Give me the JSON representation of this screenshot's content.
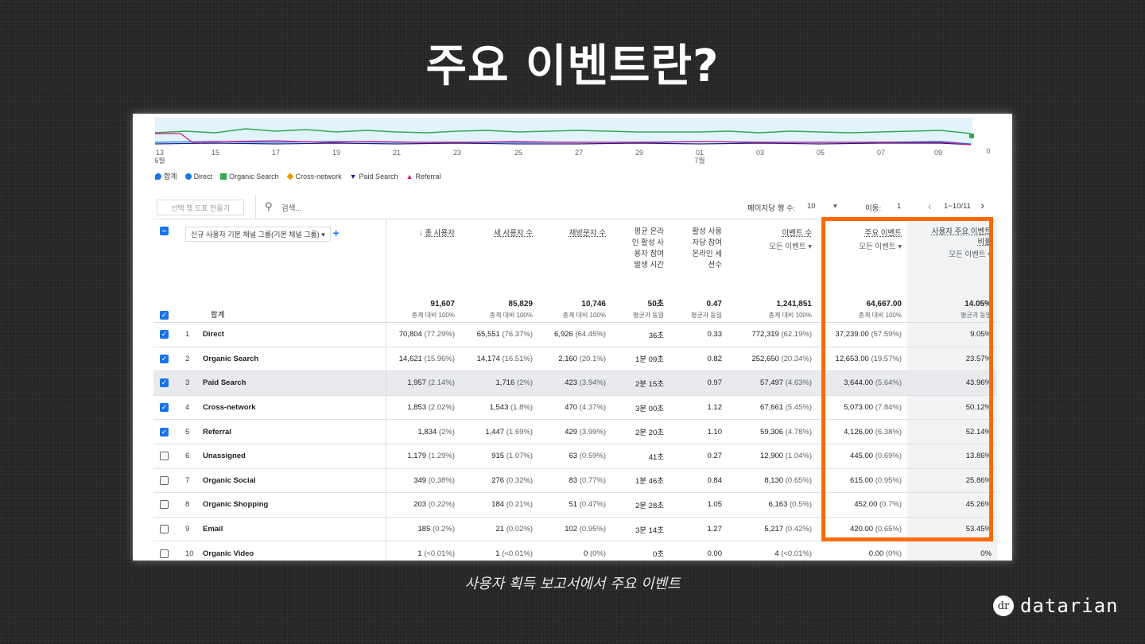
{
  "slide_title": "주요 이벤트란?",
  "caption": "사용자 획득 보고서에서 주요 이벤트",
  "brand": {
    "logo_text": "dr",
    "name": "datarian"
  },
  "chart": {
    "x_ticks": [
      "13\n6월",
      "15",
      "17",
      "19",
      "21",
      "23",
      "25",
      "27",
      "29",
      "01\n7월",
      "03",
      "05",
      "07",
      "09"
    ],
    "y_right_tick": "0",
    "legend": [
      {
        "label": "합계",
        "color": "#1a73e8",
        "icon": "pin-icon"
      },
      {
        "label": "Direct",
        "color": "#1a73e8",
        "icon": "circle-icon"
      },
      {
        "label": "Organic Search",
        "color": "#34a853",
        "icon": "square-icon"
      },
      {
        "label": "Cross-network",
        "color": "#f29900",
        "icon": "diamond-icon"
      },
      {
        "label": "Paid Search",
        "color": "#1a237e",
        "icon": "triangle-down-icon"
      },
      {
        "label": "Referral",
        "color": "#d01884",
        "icon": "triangle-up-icon"
      }
    ]
  },
  "toolbar": {
    "make_chart": "선택 행 도표 만들기",
    "search_placeholder": "검색...",
    "rows_per_page_label": "페이지당 행 수:",
    "rows_per_page": "10",
    "goto_label": "이동:",
    "goto_value": "1",
    "range": "1~10/11"
  },
  "dimension": {
    "label": "신규 사용자 기본 채널 그룹(기본 채널 그룹)"
  },
  "columns": [
    {
      "label": "총 사용자",
      "sub": ""
    },
    {
      "label": "새 사용자 수",
      "sub": ""
    },
    {
      "label": "재방문자 수",
      "sub": ""
    },
    {
      "label": "평균 온라\n인 활성 사\n용자 참여\n발생 시간",
      "sub": ""
    },
    {
      "label": "활성 사용\n자당 참여\n온라인 세\n션수",
      "sub": ""
    },
    {
      "label": "이벤트 수",
      "sub": "모든 이벤트"
    },
    {
      "label": "주요 이벤트",
      "sub": "모든 이벤트"
    },
    {
      "label": "사용자 주요 이벤트\n비율",
      "sub": "모든 이벤트"
    }
  ],
  "totals": {
    "label": "합계",
    "values": [
      {
        "v": "91,607",
        "s": "총계 대비 100%"
      },
      {
        "v": "85,829",
        "s": "총계 대비 100%"
      },
      {
        "v": "10,746",
        "s": "총계 대비 100%"
      },
      {
        "v": "50초",
        "s": "평균과 동일"
      },
      {
        "v": "0.47",
        "s": "평균과 동일"
      },
      {
        "v": "1,241,851",
        "s": "총계 대비 100%"
      },
      {
        "v": "64,667.00",
        "s": "총계 대비 100%"
      },
      {
        "v": "14.05%",
        "s": "평균과 동일"
      }
    ]
  },
  "rows": [
    {
      "rank": "1",
      "name": "Direct",
      "checked": true,
      "c": [
        [
          "70,804",
          "(77.29%)"
        ],
        [
          "65,551",
          "(76.37%)"
        ],
        [
          "6,926",
          "(64.45%)"
        ],
        [
          "36초",
          ""
        ],
        [
          "0.33",
          ""
        ],
        [
          "772,319",
          "(62.19%)"
        ],
        [
          "37,239.00",
          "(57.59%)"
        ],
        [
          "9.05%",
          ""
        ]
      ]
    },
    {
      "rank": "2",
      "name": "Organic Search",
      "checked": true,
      "c": [
        [
          "14,621",
          "(15.96%)"
        ],
        [
          "14,174",
          "(16.51%)"
        ],
        [
          "2,160",
          "(20.1%)"
        ],
        [
          "1분 09초",
          ""
        ],
        [
          "0.82",
          ""
        ],
        [
          "252,650",
          "(20.34%)"
        ],
        [
          "12,653.00",
          "(19.57%)"
        ],
        [
          "23.57%",
          ""
        ]
      ]
    },
    {
      "rank": "3",
      "name": "Paid Search",
      "checked": true,
      "c": [
        [
          "1,957",
          "(2.14%)"
        ],
        [
          "1,716",
          "(2%)"
        ],
        [
          "423",
          "(3.94%)"
        ],
        [
          "2분 15초",
          ""
        ],
        [
          "0.97",
          ""
        ],
        [
          "57,497",
          "(4.63%)"
        ],
        [
          "3,644.00",
          "(5.64%)"
        ],
        [
          "43.96%",
          ""
        ]
      ]
    },
    {
      "rank": "4",
      "name": "Cross-network",
      "checked": true,
      "c": [
        [
          "1,853",
          "(2.02%)"
        ],
        [
          "1,543",
          "(1.8%)"
        ],
        [
          "470",
          "(4.37%)"
        ],
        [
          "3분 00초",
          ""
        ],
        [
          "1.12",
          ""
        ],
        [
          "67,661",
          "(5.45%)"
        ],
        [
          "5,073.00",
          "(7.84%)"
        ],
        [
          "50.12%",
          ""
        ]
      ]
    },
    {
      "rank": "5",
      "name": "Referral",
      "checked": true,
      "c": [
        [
          "1,834",
          "(2%)"
        ],
        [
          "1,447",
          "(1.69%)"
        ],
        [
          "429",
          "(3.99%)"
        ],
        [
          "2분 20초",
          ""
        ],
        [
          "1.10",
          ""
        ],
        [
          "59,306",
          "(4.78%)"
        ],
        [
          "4,126.00",
          "(6.38%)"
        ],
        [
          "52.14%",
          ""
        ]
      ]
    },
    {
      "rank": "6",
      "name": "Unassigned",
      "checked": false,
      "c": [
        [
          "1,179",
          "(1.29%)"
        ],
        [
          "915",
          "(1.07%)"
        ],
        [
          "63",
          "(0.59%)"
        ],
        [
          "41초",
          ""
        ],
        [
          "0.27",
          ""
        ],
        [
          "12,900",
          "(1.04%)"
        ],
        [
          "445.00",
          "(0.69%)"
        ],
        [
          "13.86%",
          ""
        ]
      ]
    },
    {
      "rank": "7",
      "name": "Organic Social",
      "checked": false,
      "c": [
        [
          "349",
          "(0.38%)"
        ],
        [
          "276",
          "(0.32%)"
        ],
        [
          "83",
          "(0.77%)"
        ],
        [
          "1분 46초",
          ""
        ],
        [
          "0.84",
          ""
        ],
        [
          "8,130",
          "(0.65%)"
        ],
        [
          "615.00",
          "(0.95%)"
        ],
        [
          "25.86%",
          ""
        ]
      ]
    },
    {
      "rank": "8",
      "name": "Organic Shopping",
      "checked": false,
      "c": [
        [
          "203",
          "(0.22%)"
        ],
        [
          "184",
          "(0.21%)"
        ],
        [
          "51",
          "(0.47%)"
        ],
        [
          "2분 28초",
          ""
        ],
        [
          "1.05",
          ""
        ],
        [
          "6,163",
          "(0.5%)"
        ],
        [
          "452.00",
          "(0.7%)"
        ],
        [
          "45.26%",
          ""
        ]
      ]
    },
    {
      "rank": "9",
      "name": "Email",
      "checked": false,
      "c": [
        [
          "185",
          "(0.2%)"
        ],
        [
          "21",
          "(0.02%)"
        ],
        [
          "102",
          "(0.95%)"
        ],
        [
          "3분 14초",
          ""
        ],
        [
          "1.27",
          ""
        ],
        [
          "5,217",
          "(0.42%)"
        ],
        [
          "420.00",
          "(0.65%)"
        ],
        [
          "53.45%",
          ""
        ]
      ]
    },
    {
      "rank": "10",
      "name": "Organic Video",
      "checked": false,
      "c": [
        [
          "1",
          "(<0.01%)"
        ],
        [
          "1",
          "(<0.01%)"
        ],
        [
          "0",
          "(0%)"
        ],
        [
          "0초",
          ""
        ],
        [
          "0.00",
          ""
        ],
        [
          "4",
          "(<0.01%)"
        ],
        [
          "0.00",
          "(0%)"
        ],
        [
          "0%",
          ""
        ]
      ]
    }
  ],
  "highlight_color": "#ff6a00"
}
